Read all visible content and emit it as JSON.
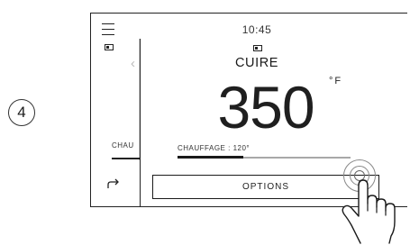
{
  "step": {
    "number": "4"
  },
  "screen": {
    "time": "10:45",
    "mode": "CUIRE",
    "temperature": "350",
    "unit": "°F",
    "heating_label": "CHAUFFAGE : 120°",
    "heating_progress": 0.38,
    "options_label": "OPTIONS"
  },
  "background_panel": {
    "heating_label_partial": "CHAU"
  },
  "icons": {
    "menu": "hamburger-icon",
    "oven": "oven-icon",
    "back": "back-arrow-icon",
    "touch": "tap-hand-icon"
  },
  "colors": {
    "ink": "#1a1a1a",
    "track": "#a8a8a8",
    "background": "#ffffff"
  }
}
